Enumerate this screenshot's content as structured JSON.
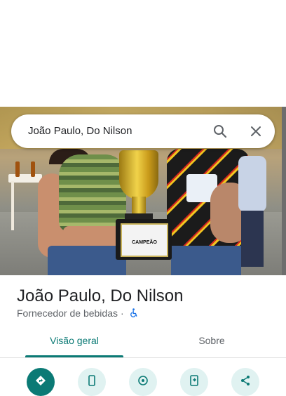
{
  "search": {
    "query": "João Paulo, Do Nilson"
  },
  "photo": {
    "plaque_text": "CAMPEÃO"
  },
  "place": {
    "name": "João Paulo, Do Nilson",
    "category": "Fornecedor de bebidas",
    "separator": "·",
    "accessibility_icon": "wheelchair-icon"
  },
  "tabs": [
    {
      "label": "Visão geral",
      "active": true
    },
    {
      "label": "Sobre",
      "active": false
    }
  ],
  "actions": [
    {
      "icon": "directions-icon"
    },
    {
      "icon": "phone-icon"
    },
    {
      "icon": "save-location-icon"
    },
    {
      "icon": "send-to-phone-icon"
    },
    {
      "icon": "share-icon"
    }
  ],
  "colors": {
    "accent": "#0b7a75",
    "accent_light": "#e0f2f1",
    "text_primary": "#202124",
    "text_secondary": "#5f6368",
    "link_blue": "#1a73e8"
  }
}
